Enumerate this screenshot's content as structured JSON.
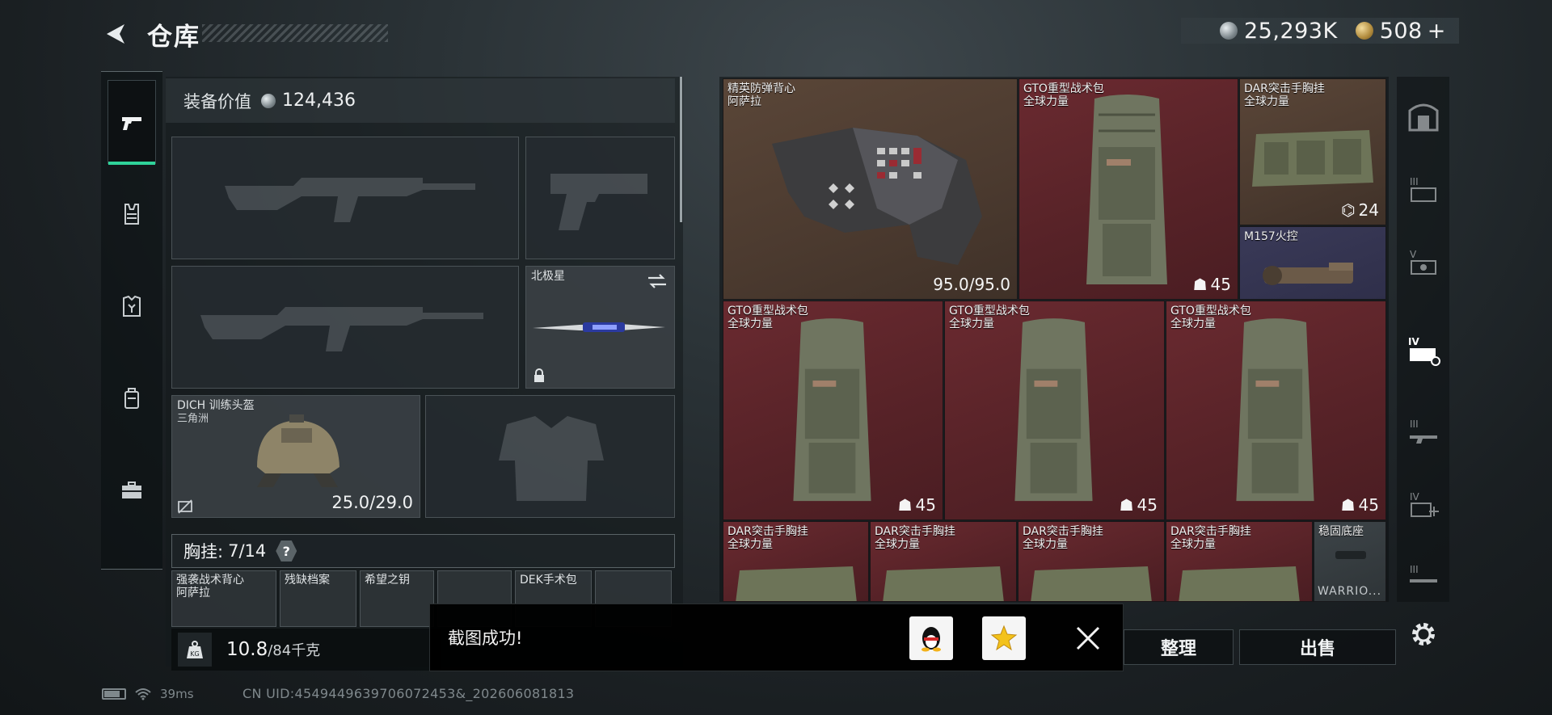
{
  "header": {
    "title": "仓库",
    "currency_silver": "25,293K",
    "currency_gold": "508",
    "currency_add": "+"
  },
  "left_nav": {
    "items": [
      {
        "icon": "pistol-icon",
        "active": true
      },
      {
        "icon": "chest-rig-icon",
        "active": false
      },
      {
        "icon": "body-armor-icon",
        "active": false
      },
      {
        "icon": "backpack-icon",
        "active": false
      },
      {
        "icon": "briefcase-icon",
        "active": false
      }
    ]
  },
  "equipment": {
    "label": "装备价值",
    "value": "124,436",
    "melee_name": "北极星",
    "helmet_name": "DICH 训练头盔",
    "helmet_sub": "三角洲",
    "helmet_durability": "25.0/29.0",
    "chest_rig_label": "胸挂:",
    "chest_rig_count": "7/14",
    "help": "?",
    "pockets": [
      {
        "name": "强袭战术背心",
        "sub": "阿萨拉"
      },
      {
        "name": "残缺档案",
        "sub": ""
      },
      {
        "name": "希望之钥",
        "sub": ""
      },
      {
        "name": "",
        "sub": ""
      },
      {
        "name": "DEK手术包",
        "sub": ""
      },
      {
        "name": "",
        "sub": ""
      }
    ]
  },
  "weight": {
    "icon_text": "KG",
    "current": "10.8",
    "max": "/84千克"
  },
  "inventory": {
    "cells": [
      {
        "name": "精英防弹背心",
        "sub": "阿萨拉",
        "value": "95.0/95.0",
        "rarity": "#b2353f"
      },
      {
        "name": "GTO重型战术包",
        "sub": "全球力量",
        "value": "45",
        "rarity": "#b2353f"
      },
      {
        "name": "DAR突击手胸挂",
        "sub": "全球力量",
        "value": "24",
        "rarity": "#8a6a4e"
      },
      {
        "name": "M157火控",
        "sub": "",
        "value": "",
        "rarity": "#4a4a78"
      },
      {
        "name": "GTO重型战术包",
        "sub": "全球力量",
        "value": "45",
        "rarity": "#b2353f"
      },
      {
        "name": "GTO重型战术包",
        "sub": "全球力量",
        "value": "45",
        "rarity": "#b2353f"
      },
      {
        "name": "GTO重型战术包",
        "sub": "全球力量",
        "value": "45",
        "rarity": "#b2353f"
      },
      {
        "name": "DAR突击手胸挂",
        "sub": "全球力量",
        "value": "",
        "rarity": "#b2353f"
      },
      {
        "name": "DAR突击手胸挂",
        "sub": "全球力量",
        "value": "",
        "rarity": "#b2353f"
      },
      {
        "name": "DAR突击手胸挂",
        "sub": "全球力量",
        "value": "",
        "rarity": "#b2353f"
      },
      {
        "name": "DAR突击手胸挂",
        "sub": "全球力量",
        "value": "",
        "rarity": "#b2353f"
      },
      {
        "name": "稳固底座",
        "sub": "",
        "value": "",
        "rarity": "#5a5f63",
        "extra": "WARRIO..."
      }
    ]
  },
  "right_tabs": [
    {
      "icon": "safe-room-icon"
    },
    {
      "icon": "tier-3-ammo-icon"
    },
    {
      "icon": "tier-5-medkit-icon"
    },
    {
      "icon": "tier-4-gear-icon",
      "active": true
    },
    {
      "icon": "tier-3-rifle-icon"
    },
    {
      "icon": "tier-4-add-icon"
    },
    {
      "icon": "tier-3-weapon-icon"
    }
  ],
  "actions": {
    "organize": "整理",
    "sell": "出售"
  },
  "toast": {
    "message": "截图成功!"
  },
  "status": {
    "ping": "39ms",
    "uid": "CN UID:4549449639706072453&_202606081813"
  },
  "colors": {
    "accent": "#2fd39a",
    "red_rarity": "#b2353f",
    "gold_rarity": "#8a6a4e",
    "purple_rarity": "#4a4a78"
  }
}
